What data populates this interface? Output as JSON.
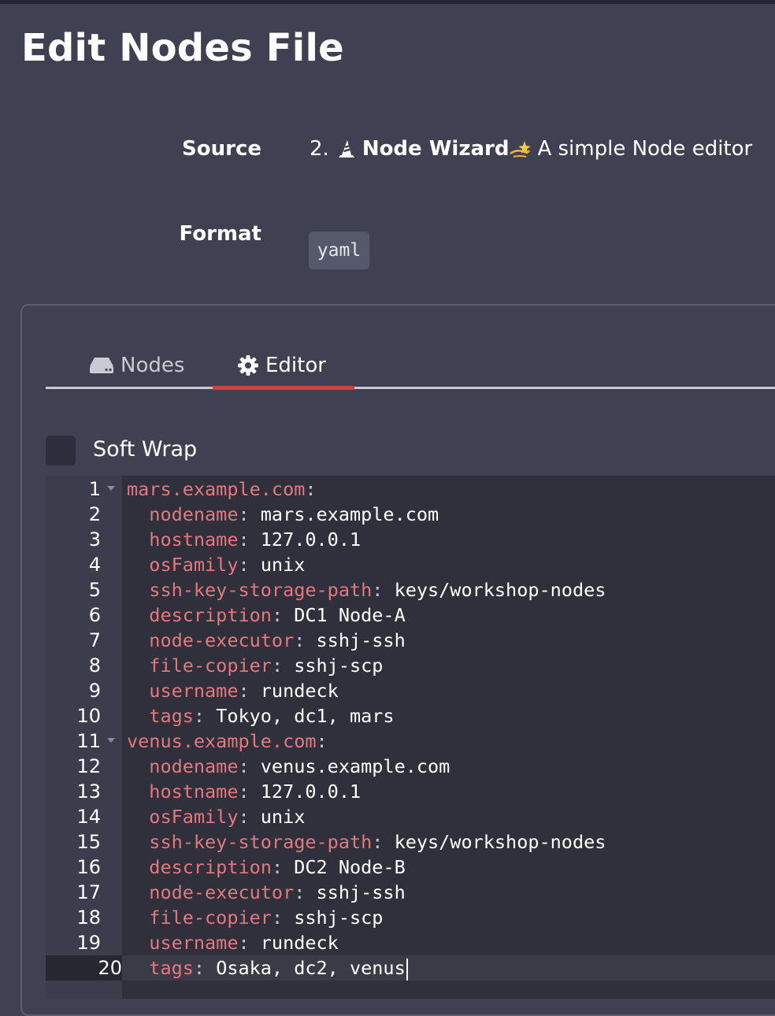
{
  "page": {
    "title": "Edit Nodes File"
  },
  "source": {
    "label": "Source",
    "number": "2.",
    "wizard_name": "Node Wizard",
    "description": "A simple Node editor",
    "icon": "wizard-hat-icon",
    "sparkle_icon": "dizzy-sparkle-icon"
  },
  "format": {
    "label": "Format",
    "value": "yaml"
  },
  "tabs": [
    {
      "label": "Nodes",
      "icon": "server-icon",
      "active": false
    },
    {
      "label": "Editor",
      "icon": "gear-icon",
      "active": true
    }
  ],
  "soft_wrap": {
    "label": "Soft Wrap",
    "checked": false
  },
  "editor": {
    "lines": [
      {
        "n": "1",
        "indent": "",
        "key": "mars.example.com",
        "value": "",
        "fold": true
      },
      {
        "n": "2",
        "indent": "  ",
        "key": "nodename",
        "value": "mars.example.com"
      },
      {
        "n": "3",
        "indent": "  ",
        "key": "hostname",
        "value": "127.0.0.1"
      },
      {
        "n": "4",
        "indent": "  ",
        "key": "osFamily",
        "value": "unix"
      },
      {
        "n": "5",
        "indent": "  ",
        "key": "ssh-key-storage-path",
        "value": "keys/workshop-nodes"
      },
      {
        "n": "6",
        "indent": "  ",
        "key": "description",
        "value": "DC1 Node-A"
      },
      {
        "n": "7",
        "indent": "  ",
        "key": "node-executor",
        "value": "sshj-ssh"
      },
      {
        "n": "8",
        "indent": "  ",
        "key": "file-copier",
        "value": "sshj-scp"
      },
      {
        "n": "9",
        "indent": "  ",
        "key": "username",
        "value": "rundeck"
      },
      {
        "n": "10",
        "indent": "  ",
        "key": "tags",
        "value": "Tokyo, dc1, mars"
      },
      {
        "n": "11",
        "indent": "",
        "key": "venus.example.com",
        "value": "",
        "fold": true
      },
      {
        "n": "12",
        "indent": "  ",
        "key": "nodename",
        "value": "venus.example.com"
      },
      {
        "n": "13",
        "indent": "  ",
        "key": "hostname",
        "value": "127.0.0.1"
      },
      {
        "n": "14",
        "indent": "  ",
        "key": "osFamily",
        "value": "unix"
      },
      {
        "n": "15",
        "indent": "  ",
        "key": "ssh-key-storage-path",
        "value": "keys/workshop-nodes"
      },
      {
        "n": "16",
        "indent": "  ",
        "key": "description",
        "value": "DC2 Node-B"
      },
      {
        "n": "17",
        "indent": "  ",
        "key": "node-executor",
        "value": "sshj-ssh"
      },
      {
        "n": "18",
        "indent": "  ",
        "key": "file-copier",
        "value": "sshj-scp"
      },
      {
        "n": "19",
        "indent": "  ",
        "key": "username",
        "value": "rundeck"
      },
      {
        "n": "20",
        "indent": "  ",
        "key": "tags",
        "value": "Osaka, dc2, venus",
        "active": true
      }
    ]
  },
  "colors": {
    "background": "#3f4152",
    "accent": "#d2413c",
    "yaml_key": "#e4787c",
    "editor_bg": "#2f303c"
  }
}
